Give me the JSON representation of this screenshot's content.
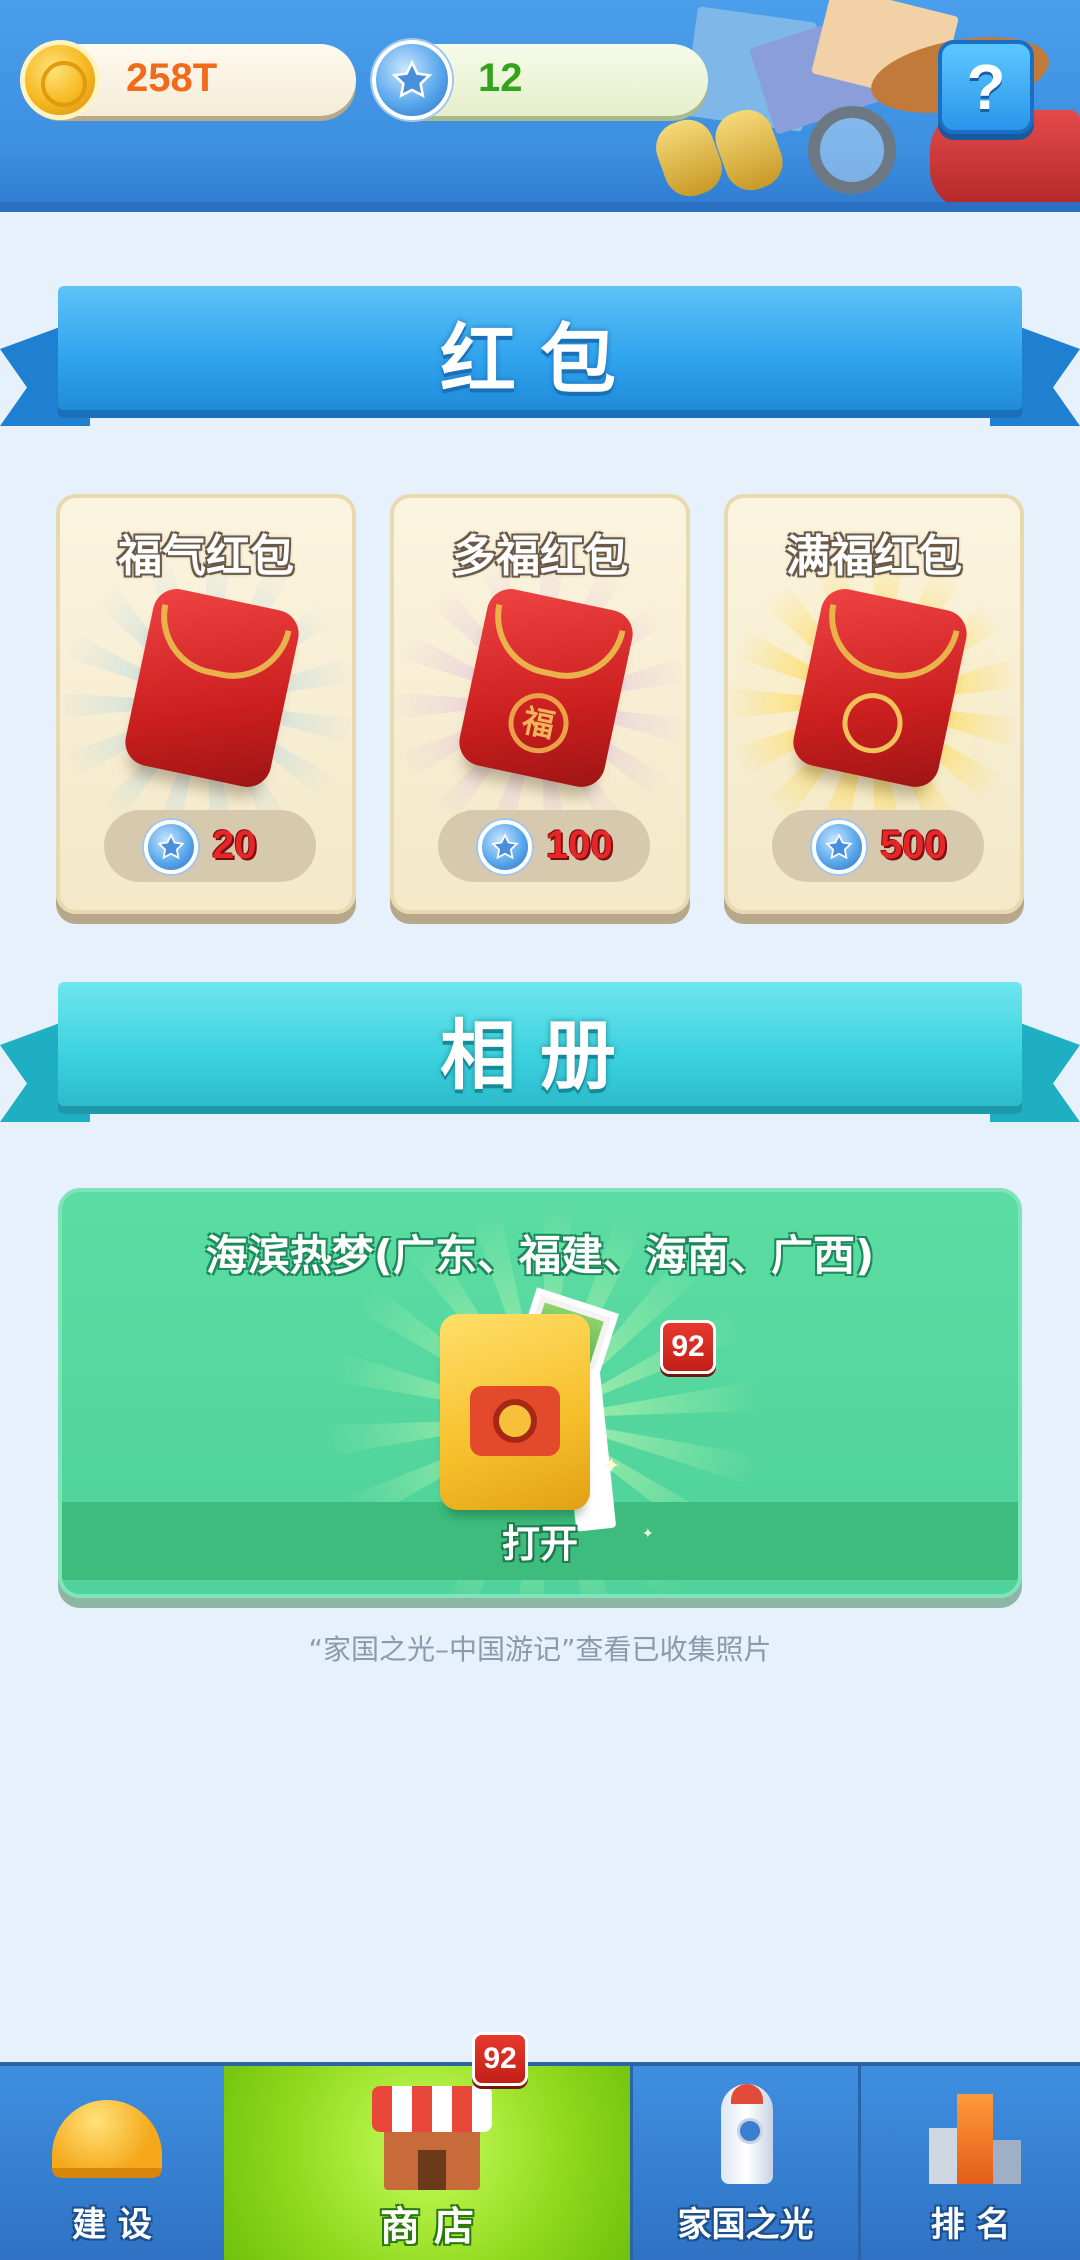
{
  "header": {
    "coins": "258T",
    "stars": "12",
    "help_label": "?"
  },
  "red_packet_section": {
    "title": "红包",
    "items": [
      {
        "name": "福气红包",
        "price": "20",
        "emblem": ""
      },
      {
        "name": "多福红包",
        "price": "100",
        "emblem": "福"
      },
      {
        "name": "满福红包",
        "price": "500",
        "emblem": ""
      }
    ]
  },
  "album_section": {
    "title": "相册",
    "album_name": "海滨热梦(广东、福建、海南、广西)",
    "badge_count": "92",
    "open_label": "打开",
    "hint": "“家国之光–中国游记”查看已收集照片"
  },
  "bottom_nav": {
    "items": [
      {
        "label": "建 设",
        "icon": "helmet-icon"
      },
      {
        "label": "商 店",
        "icon": "shop-icon",
        "badge": "92",
        "active": true
      },
      {
        "label": "家国之光",
        "icon": "rocket-icon"
      },
      {
        "label": "排 名",
        "icon": "podium-icon"
      }
    ]
  },
  "colors": {
    "accent_blue": "#2fa3ee",
    "album_green": "#4fd29b",
    "price_red": "#e8262a",
    "nav_active": "#8fd81e"
  }
}
